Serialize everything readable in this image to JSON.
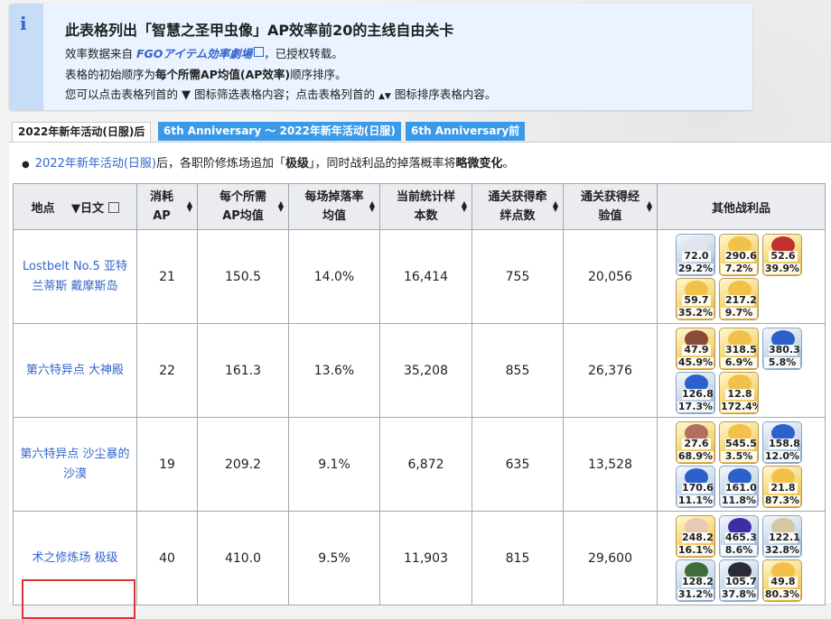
{
  "info": {
    "icon": "info-icon",
    "title": "此表格列出「智慧之圣甲虫像」AP效率前20的主线自由关卡",
    "line1_pre": "效率数据来自",
    "line1_link": "FGOアイテム効率劇場",
    "line1_post": "，已授权转载。",
    "line2_pre": "表格的初始顺序为",
    "line2_bold": "每个所需AP均值(AP效率)",
    "line2_post": "顺序排序。",
    "line3_a": "您可以点击表格列首的",
    "line3_b": "图标筛选表格内容；点击表格列首的",
    "line3_c": "图标排序表格内容。"
  },
  "tabs": [
    {
      "label": "2022年新年活动(日服)后",
      "active": true
    },
    {
      "label": "6th Anniversary ～ 2022年新年活动(日服)",
      "active": false
    },
    {
      "label": "6th Anniversary前",
      "active": false
    }
  ],
  "note": {
    "link": "2022年新年活动(日服)",
    "mid": "后，各职阶修炼场追加「",
    "bold1": "极级",
    "mid2": "」，同时战利品的掉落概率将",
    "bold2": "略微变化",
    "end": "。"
  },
  "headers": {
    "location": "地点",
    "filter": "日文",
    "ap": "消耗AP",
    "ap_avg": "每个所需AP均值",
    "drop": "每场掉落率均值",
    "samples": "当前统计样本数",
    "bond": "通关获得牵绊点数",
    "exp": "通关获得经验值",
    "other": "其他战利品"
  },
  "rows": [
    {
      "loc": "Lostbelt No.5 亚特兰蒂斯 戴摩斯岛",
      "ap": "21",
      "avg": "150.5",
      "rate": "14.0%",
      "n": "16,414",
      "bond": "755",
      "exp": "20,056",
      "items": [
        {
          "q": "72.0",
          "r": "29.2%",
          "c": "blue",
          "icon": "dragon-bone-icon"
        },
        {
          "q": "290.6",
          "r": "7.2%",
          "c": "gold",
          "icon": "gold-shard-icon"
        },
        {
          "q": "52.6",
          "r": "39.9%",
          "c": "gold",
          "icon": "red-item-icon"
        },
        {
          "q": "59.7",
          "r": "35.2%",
          "c": "gold",
          "icon": "gold-shard-icon"
        },
        {
          "q": "217.2",
          "r": "9.7%",
          "c": "gold",
          "icon": "gold-shard-icon"
        }
      ]
    },
    {
      "loc": "第六特异点 大神殿",
      "ap": "22",
      "avg": "161.3",
      "rate": "13.6%",
      "n": "35,208",
      "bond": "855",
      "exp": "26,376",
      "items": [
        {
          "q": "47.9",
          "r": "45.9%",
          "c": "gold",
          "icon": "chain-icon"
        },
        {
          "q": "318.5",
          "r": "6.9%",
          "c": "gold",
          "icon": "gold-shard-icon"
        },
        {
          "q": "380.3",
          "r": "5.8%",
          "c": "blue",
          "icon": "blue-gem-icon"
        },
        {
          "q": "126.8",
          "r": "17.3%",
          "c": "blue",
          "icon": "blue-gem-icon"
        },
        {
          "q": "12.8",
          "r": "172.4%",
          "c": "gold",
          "icon": "gold-shard-icon"
        }
      ]
    },
    {
      "loc": "第六特异点 沙尘暴的沙漠",
      "ap": "19",
      "avg": "209.2",
      "rate": "9.1%",
      "n": "6,872",
      "bond": "635",
      "exp": "13,528",
      "items": [
        {
          "q": "27.6",
          "r": "68.9%",
          "c": "gold",
          "icon": "bone-icon"
        },
        {
          "q": "545.5",
          "r": "3.5%",
          "c": "gold",
          "icon": "gold-shard-icon"
        },
        {
          "q": "158.8",
          "r": "12.0%",
          "c": "blue",
          "icon": "blue-gem-icon"
        },
        {
          "q": "170.6",
          "r": "11.1%",
          "c": "blue",
          "icon": "blue-gem-icon"
        },
        {
          "q": "161.0",
          "r": "11.8%",
          "c": "blue",
          "icon": "blue-gem-icon"
        },
        {
          "q": "21.8",
          "r": "87.3%",
          "c": "gold",
          "icon": "gold-shard-icon"
        }
      ]
    },
    {
      "loc": "术之修炼场 极级",
      "ap": "40",
      "avg": "410.0",
      "rate": "9.5%",
      "n": "11,903",
      "bond": "815",
      "exp": "29,600",
      "items": [
        {
          "q": "248.2",
          "r": "16.1%",
          "c": "gold",
          "icon": "feather-icon"
        },
        {
          "q": "465.3",
          "r": "8.6%",
          "c": "blue",
          "icon": "purple-gem-icon"
        },
        {
          "q": "122.1",
          "r": "32.8%",
          "c": "blue",
          "icon": "scroll-icon"
        },
        {
          "q": "128.2",
          "r": "31.2%",
          "c": "blue",
          "icon": "leaf-icon"
        },
        {
          "q": "105.7",
          "r": "37.8%",
          "c": "blue",
          "icon": "dark-orb-icon"
        },
        {
          "q": "49.8",
          "r": "80.3%",
          "c": "gold",
          "icon": "gold-shard-icon"
        }
      ]
    }
  ],
  "colors": {
    "link": "#3366cc",
    "tab": "#3a9ae8",
    "highlight": "#dd3333"
  }
}
